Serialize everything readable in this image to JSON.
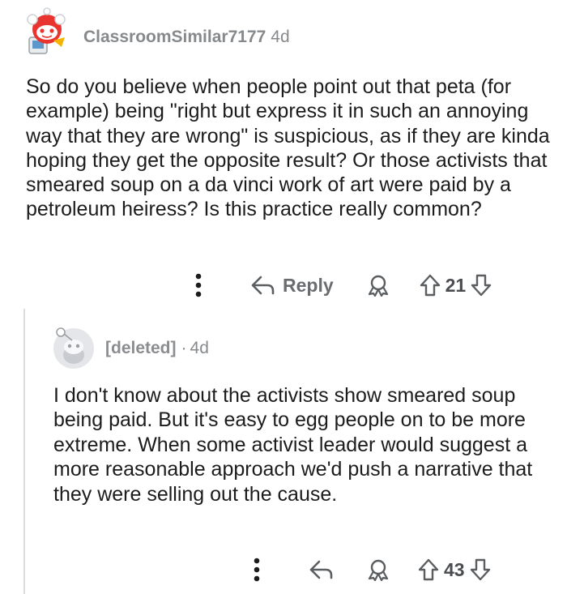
{
  "comment": {
    "username": "ClassroomSimilar7177",
    "age": "4d",
    "body": "So do you believe when people point out that peta (for example) being \"right but express it in such an annoying way that they are wrong\" is suspicious, as if they are kinda hoping they get the opposite result? Or those activists that smeared soup on a da vinci work of art were paid by a petroleum heiress? Is this practice really common?",
    "actions": {
      "reply_label": "Reply",
      "score": "21"
    }
  },
  "reply": {
    "username": "[deleted]",
    "separator": "·",
    "age": "4d",
    "body": "I don't know about the activists show smeared soup being paid. But it's easy to egg people on to be more extreme. When some activist leader would suggest a more reasonable approach we'd push a narrative that they were selling out the cause.",
    "actions": {
      "score": "43"
    }
  },
  "icons": {
    "avatar_top": "snoo-avatar-icon",
    "avatar_bottom": "default-snoo-avatar-icon",
    "more": "more-options-icon",
    "reply": "reply-arrow-icon",
    "award": "award-icon",
    "upvote": "upvote-arrow-icon",
    "downvote": "downvote-arrow-icon"
  },
  "colors": {
    "meta_gray": "#878a8c",
    "thread_line": "#dcdde0",
    "avatar_red": "#e8352f"
  }
}
